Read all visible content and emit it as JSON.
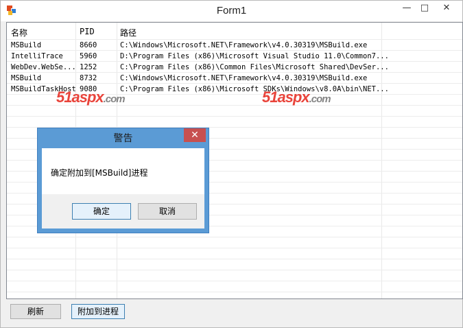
{
  "window": {
    "title": "Form1",
    "minimize_glyph": "—",
    "maximize_glyph": "□",
    "close_glyph": "✕"
  },
  "listview": {
    "columns": [
      "名称",
      "PID",
      "路径"
    ],
    "rows": [
      {
        "name": "MSBuild",
        "pid": "8660",
        "path": "C:\\Windows\\Microsoft.NET\\Framework\\v4.0.30319\\MSBuild.exe"
      },
      {
        "name": "IntelliTrace",
        "pid": "5960",
        "path": "D:\\Program Files (x86)\\Microsoft Visual Studio 11.0\\Common7..."
      },
      {
        "name": "WebDev.WebSe...",
        "pid": "1252",
        "path": "C:\\Program Files (x86)\\Common Files\\Microsoft Shared\\DevSer..."
      },
      {
        "name": "MSBuild",
        "pid": "8732",
        "path": "C:\\Windows\\Microsoft.NET\\Framework\\v4.0.30319\\MSBuild.exe"
      },
      {
        "name": "MSBuildTaskHost",
        "pid": "9080",
        "path": "C:\\Program Files (x86)\\Microsoft SDKs\\Windows\\v8.0A\\bin\\NET..."
      }
    ]
  },
  "watermark": {
    "brand": "51aspx",
    "domain": ".com"
  },
  "dialog": {
    "title": "警告",
    "close_glyph": "✕",
    "message": "确定附加到[MSBuild]进程",
    "ok_label": "确定",
    "cancel_label": "取消"
  },
  "buttons": {
    "refresh_label": "刷新",
    "attach_label": "附加到进程"
  },
  "colors": {
    "dialog_frame": "#5b9bd5",
    "dialog_close": "#c75050",
    "watermark_red": "#e8352b"
  }
}
